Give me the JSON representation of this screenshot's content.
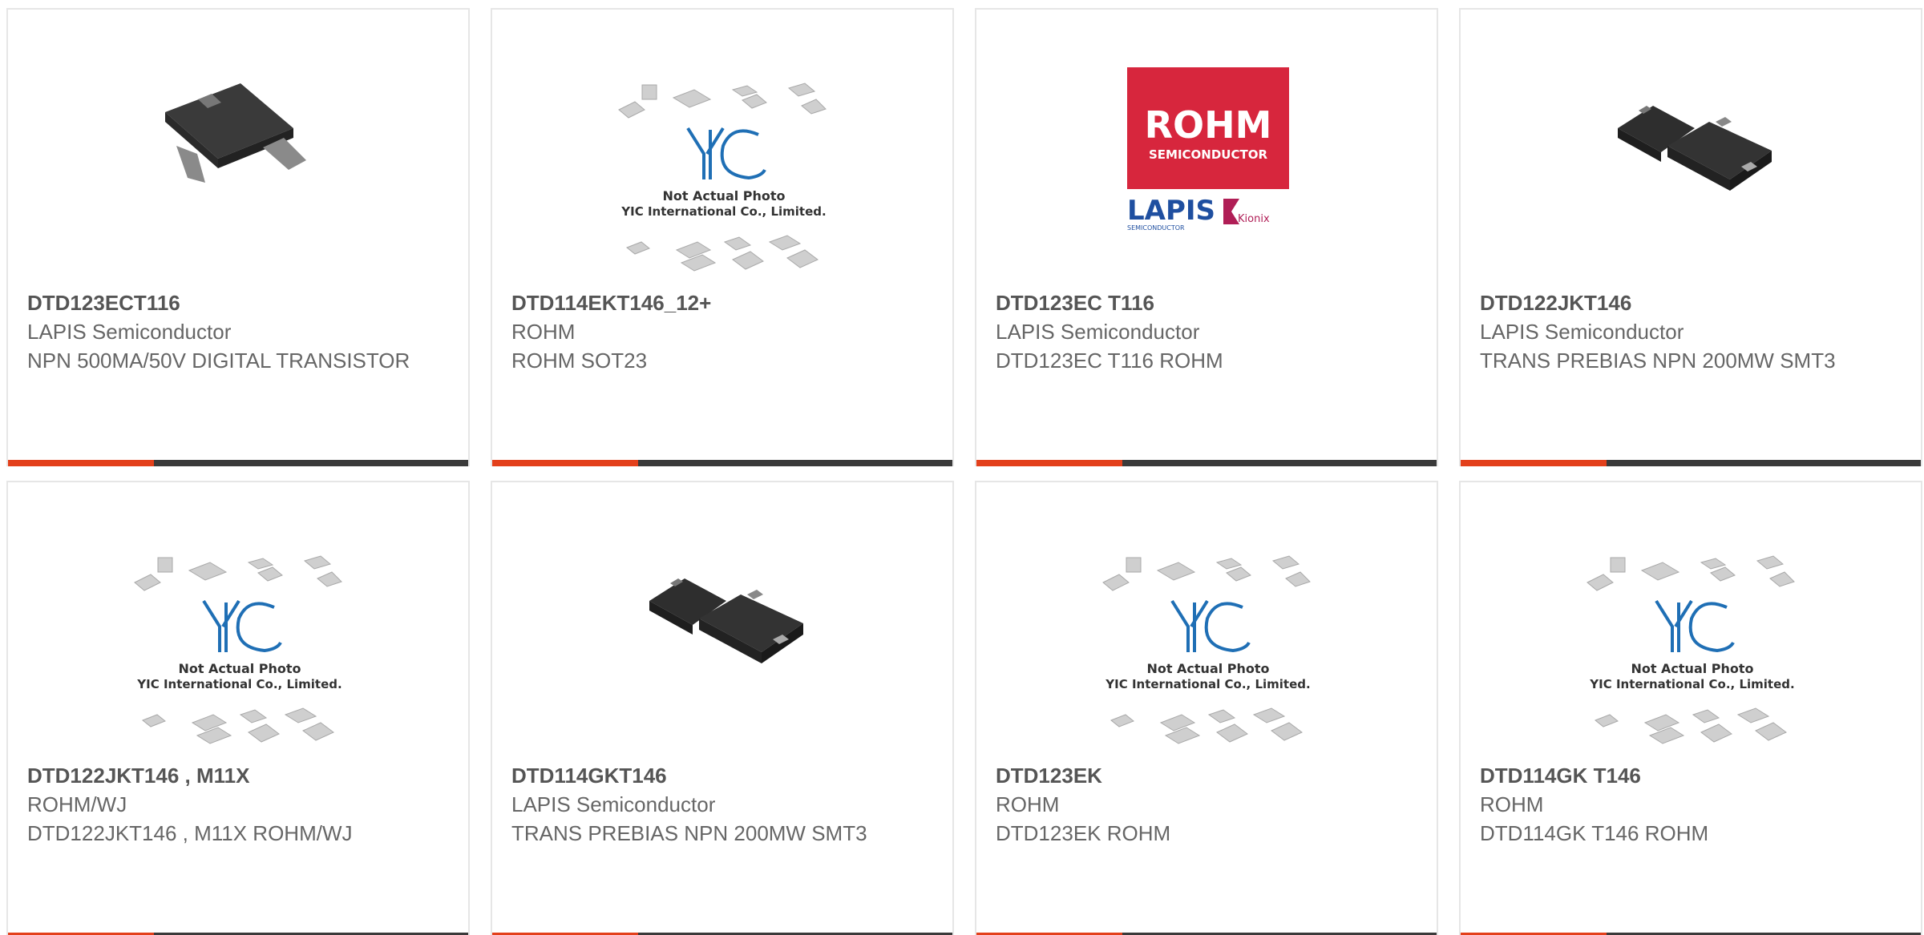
{
  "colors": {
    "accent": "#e3401b",
    "bar": "#3a3a3a",
    "border": "#e6e6e6",
    "text": "#666666",
    "rohm_red": "#d7263d",
    "yic_blue": "#1f6fb5"
  },
  "products": [
    {
      "part": "DTD123ECT116",
      "manufacturer": "LAPIS Semiconductor",
      "description": "NPN 500MA/50V DIGITAL TRANSISTOR",
      "image": "sot23-package-photo"
    },
    {
      "part": "DTD114EKT146_12+",
      "manufacturer": "ROHM",
      "description": "ROHM SOT23",
      "image": "yic-placeholder"
    },
    {
      "part": "DTD123EC T116",
      "manufacturer": "LAPIS Semiconductor",
      "description": "DTD123EC T116 ROHM",
      "image": "rohm-logo"
    },
    {
      "part": "DTD122JKT146",
      "manufacturer": "LAPIS Semiconductor",
      "description": "TRANS PREBIAS NPN 200MW SMT3",
      "image": "sot23-package-photo"
    },
    {
      "part": "DTD122JKT146 , M11X",
      "manufacturer": "ROHM/WJ",
      "description": "DTD122JKT146 , M11X ROHM/WJ",
      "image": "yic-placeholder"
    },
    {
      "part": "DTD114GKT146",
      "manufacturer": "LAPIS Semiconductor",
      "description": "TRANS PREBIAS NPN 200MW SMT3",
      "image": "sot23-package-photo"
    },
    {
      "part": "DTD123EK",
      "manufacturer": "ROHM",
      "description": "DTD123EK ROHM",
      "image": "yic-placeholder"
    },
    {
      "part": "DTD114GK T146",
      "manufacturer": "ROHM",
      "description": "DTD114GK T146 ROHM",
      "image": "yic-placeholder"
    }
  ],
  "yic_placeholder": {
    "line1": "Not Actual Photo",
    "line2": "YIC International Co., Limited."
  },
  "rohm_logo": {
    "brand": "ROHM",
    "sub": "SEMICONDUCTOR",
    "lapis": "LAPIS",
    "lapis_sub": "SEMICONDUCTOR",
    "kionix": "Kionix"
  }
}
